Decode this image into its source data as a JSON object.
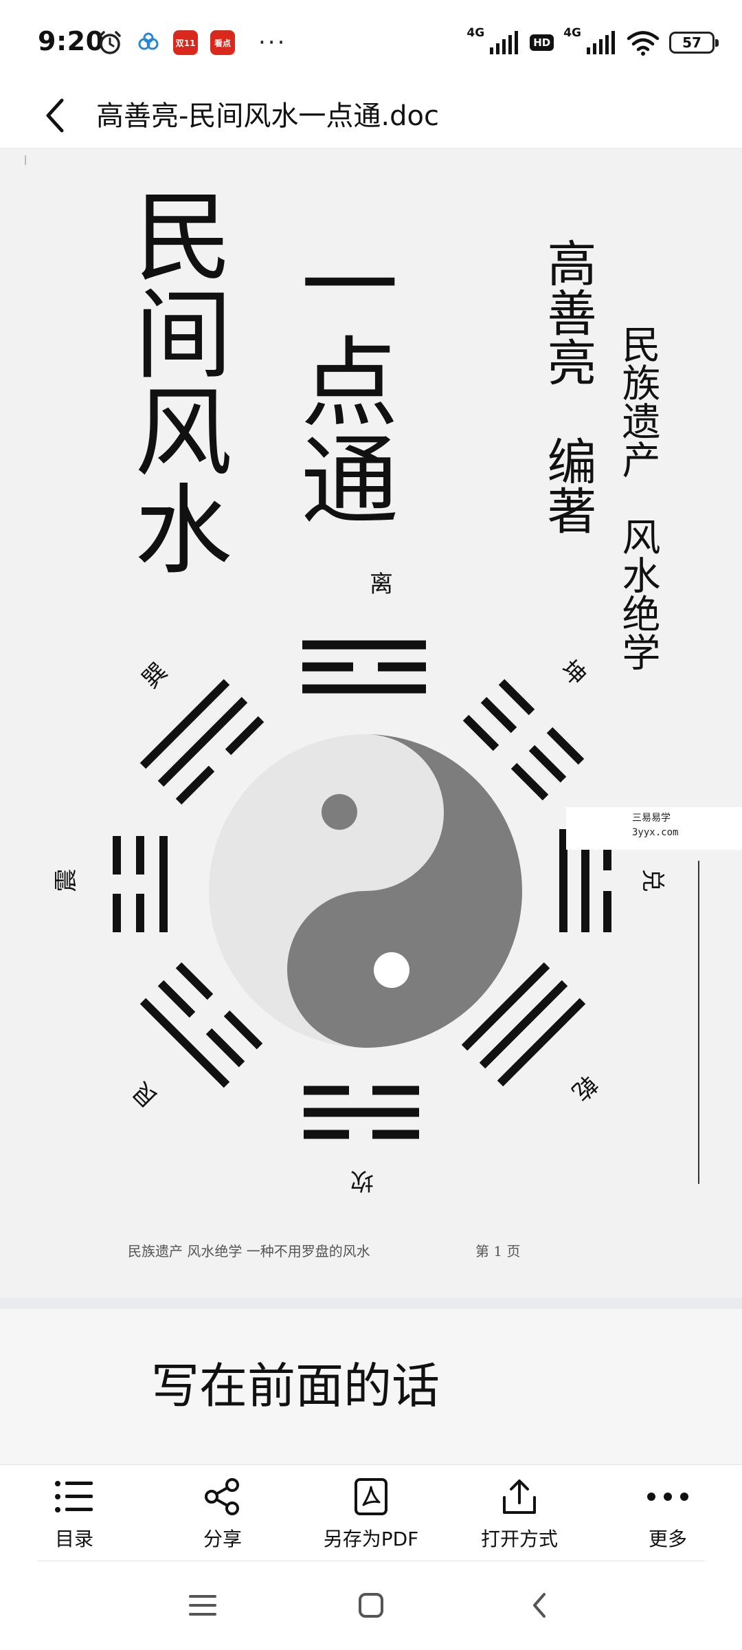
{
  "status_bar": {
    "time": "9:20",
    "app_badges": [
      "双11",
      "看点"
    ],
    "more": "···",
    "network_1": "4G",
    "hd": "HD",
    "network_2": "4G",
    "battery": "57"
  },
  "header": {
    "title": "高善亮-民间风水一点通.doc"
  },
  "document": {
    "main_title": "民间风水",
    "sub_title": "一点通",
    "author": "高善亮　编著",
    "slogan": "民族遗产　风水绝学",
    "trigrams": {
      "li": "离",
      "kun": "坤",
      "dui": "兑",
      "qian": "乾",
      "kan": "坎",
      "gen": "艮",
      "zhen": "震",
      "xun": "巽"
    },
    "watermark_line1": "三易易学",
    "watermark_line2": "3yyx.com",
    "footer_text": "民族遗产 风水绝学 一种不用罗盘的风水",
    "footer_page": "第 1 页",
    "next_heading": "写在前面的话"
  },
  "toolbar": {
    "items": [
      {
        "label": "目录",
        "icon": "list-icon"
      },
      {
        "label": "分享",
        "icon": "share-icon"
      },
      {
        "label": "另存为PDF",
        "icon": "pdf-icon"
      },
      {
        "label": "打开方式",
        "icon": "open-with-icon"
      },
      {
        "label": "更多",
        "icon": "more-icon"
      }
    ]
  },
  "colors": {
    "yang": "#e6e6e6",
    "yin": "#7d7d7d",
    "line": "#111111"
  }
}
